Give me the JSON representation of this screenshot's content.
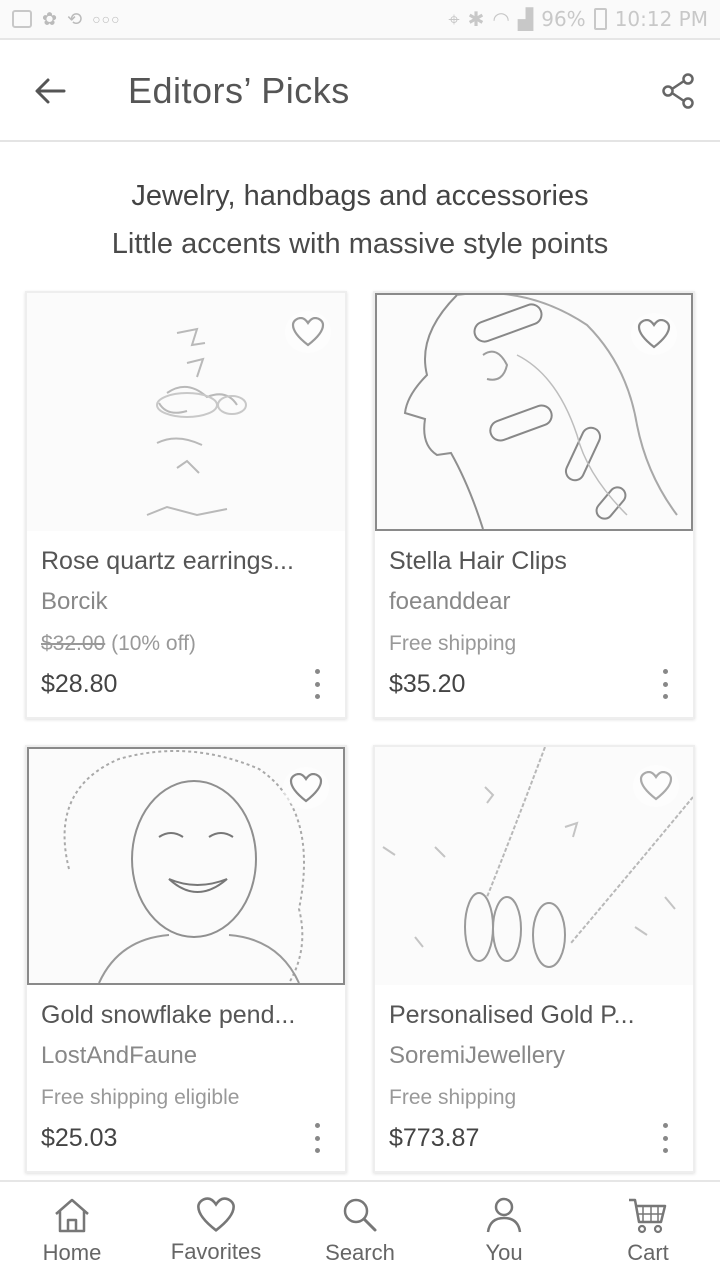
{
  "status_bar": {
    "battery": "96%",
    "time": "10:12 PM"
  },
  "app_bar": {
    "title": "Editors’ Picks"
  },
  "header": {
    "line1": "Jewelry, handbags and accessories",
    "line2": "Little accents with massive style points"
  },
  "products": [
    {
      "name": "Rose quartz earrings...",
      "shop": "Borcik",
      "original_price": "$32.00",
      "discount": "(10% off)",
      "price": "$28.80"
    },
    {
      "name": "Stella Hair Clips",
      "shop": "foeanddear",
      "shipping": "Free shipping",
      "price": "$35.20"
    },
    {
      "name": "Gold snowflake pend...",
      "shop": "LostAndFaune",
      "shipping": "Free shipping eligible",
      "price": "$25.03"
    },
    {
      "name": "Personalised Gold P...",
      "shop": "SoremiJewellery",
      "shipping": "Free shipping",
      "price": "$773.87"
    }
  ],
  "bottom_nav": {
    "items": [
      {
        "label": "Home",
        "icon": "home-icon"
      },
      {
        "label": "Favorites",
        "icon": "heart-icon"
      },
      {
        "label": "Search",
        "icon": "search-icon"
      },
      {
        "label": "You",
        "icon": "person-icon"
      },
      {
        "label": "Cart",
        "icon": "cart-icon"
      }
    ]
  }
}
